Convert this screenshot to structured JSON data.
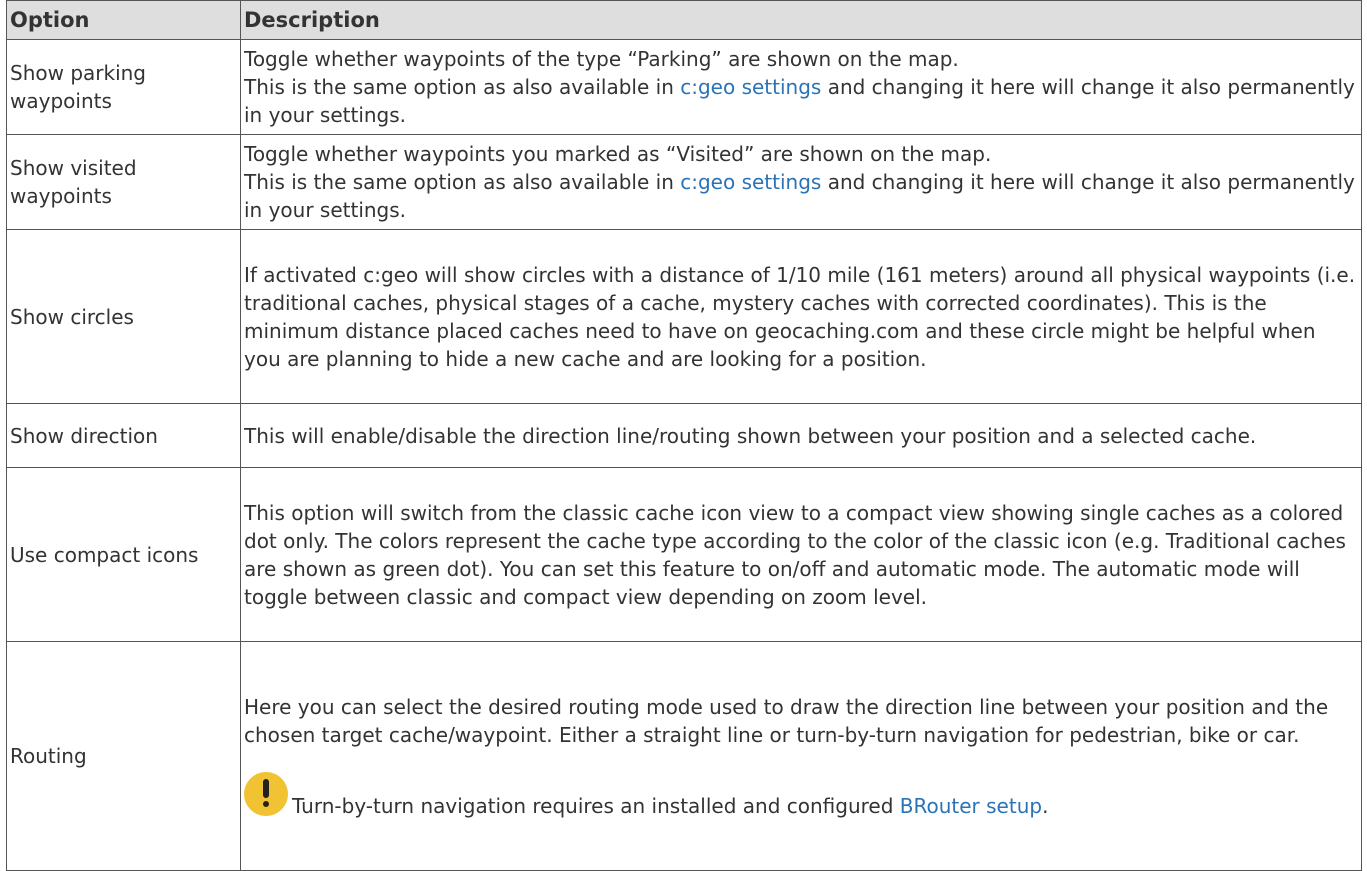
{
  "table": {
    "headers": {
      "option": "Option",
      "description": "Description"
    },
    "rows": [
      {
        "option": "Show parking waypoints",
        "lines": [
          {
            "text": "Toggle whether waypoints of the type “Parking” are shown on the map."
          },
          {
            "pre": "This is the same option as also available in ",
            "link": "c:geo settings",
            "post": " and changing it here will change it also permanently in your settings."
          }
        ]
      },
      {
        "option": "Show visited waypoints",
        "lines": [
          {
            "text": "Toggle whether waypoints you marked as “Visited” are shown on the map."
          },
          {
            "pre": "This is the same option as also available in ",
            "link": "c:geo settings",
            "post": " and changing it here will change it also permanently in your settings."
          }
        ]
      },
      {
        "option": "Show circles",
        "text": "If activated c:geo will show circles with a distance of 1/10 mile (161 meters) around all physical waypoints (i.e. traditional caches, physical stages of a cache, mystery caches with corrected coordinates). This is the minimum distance placed caches need to have on geocaching.com and these circle might be helpful when you are planning to hide a new cache and are looking for a position."
      },
      {
        "option": "Show direction",
        "text": "This will enable/disable the direction line/routing shown between your position and a selected cache."
      },
      {
        "option": "Use compact icons",
        "text": "This option will switch from the classic cache icon view to a compact view showing single caches as a colored dot only. The colors represent the cache type according to the color of the classic icon (e.g. Traditional caches are shown as green dot). You can set this feature to on/off and automatic mode. The automatic mode will toggle between classic and compact view depending on zoom level."
      },
      {
        "option": "Routing",
        "text": "Here you can select the desired routing mode used to draw the direction line between your position and the chosen target cache/waypoint. Either a straight line or turn-by-turn navigation for pedestrian, bike or car.",
        "note": {
          "icon": "exclamation-icon",
          "pre": "Turn-by-turn navigation requires an installed and configured ",
          "link": "BRouter setup",
          "post": "."
        }
      }
    ]
  },
  "colors": {
    "link": "#2b73b7",
    "header_bg": "#dedede",
    "border": "#555555",
    "text": "#333333",
    "note_icon": "#f1c232"
  }
}
